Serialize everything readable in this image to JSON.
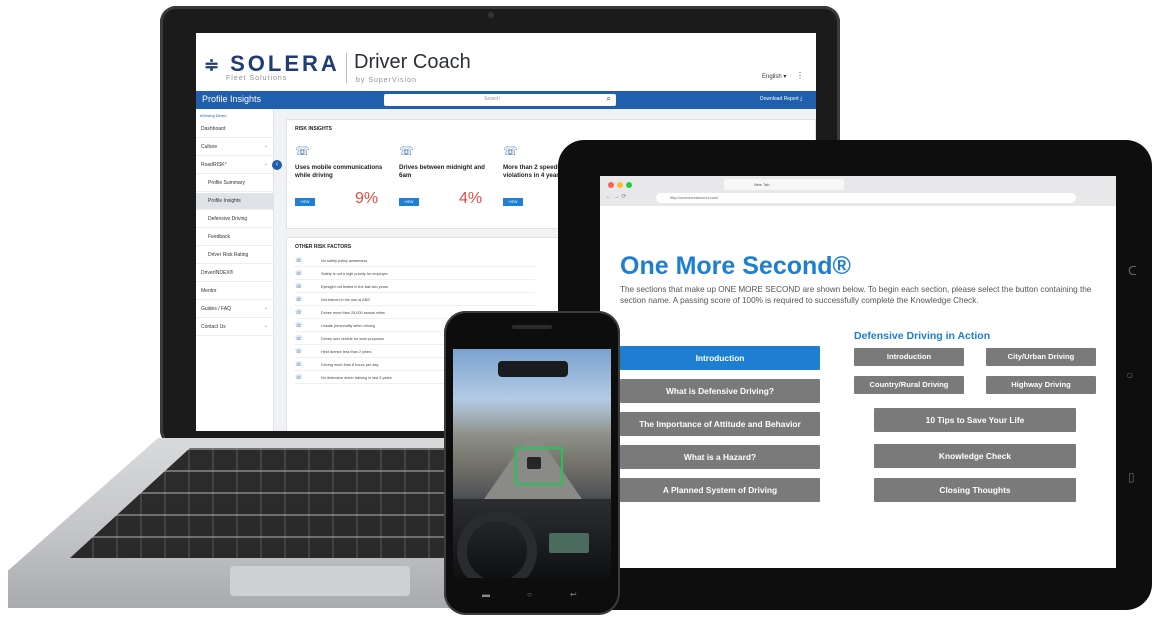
{
  "laptop": {
    "logo": "SOLERA",
    "logo_sub": "Fleet Solutions",
    "app_title": "Driver Coach",
    "app_subtitle": "by SuperVision",
    "language": "English ▾",
    "menu_icon": "⋮",
    "bar_title": "Profile Insights",
    "search_placeholder": "Search",
    "download": "Download Report",
    "sidebar_head": "eDriving Demo",
    "sidebar": [
      {
        "label": "Dashboard",
        "sub": false,
        "active": false,
        "chev": ""
      },
      {
        "label": "Culture",
        "sub": false,
        "active": false,
        "chev": "⌄"
      },
      {
        "label": "RoadRISK°",
        "sub": false,
        "active": false,
        "chev": "⌄"
      },
      {
        "label": "Profile Summary",
        "sub": true,
        "active": false,
        "chev": ""
      },
      {
        "label": "Profile Insights",
        "sub": true,
        "active": true,
        "chev": ""
      },
      {
        "label": "Defensive Driving",
        "sub": true,
        "active": false,
        "chev": ""
      },
      {
        "label": "Feedback",
        "sub": true,
        "active": false,
        "chev": ""
      },
      {
        "label": "Driver Risk Rating",
        "sub": true,
        "active": false,
        "chev": ""
      },
      {
        "label": "DriverINDEX®",
        "sub": false,
        "active": false,
        "chev": ""
      },
      {
        "label": "Mentor",
        "sub": false,
        "active": false,
        "chev": ""
      },
      {
        "label": "Guides / FAQ",
        "sub": false,
        "active": false,
        "chev": "⌄"
      },
      {
        "label": "Contact Us",
        "sub": false,
        "active": false,
        "chev": "⌄"
      }
    ],
    "risk_insights_title": "RISK INSIGHTS",
    "risks": [
      {
        "text": "Uses mobile communications while driving",
        "button": "VIEW",
        "pct": "9%"
      },
      {
        "text": "Drives between midnight and 6am",
        "button": "VIEW",
        "pct": "4%"
      },
      {
        "text": "More than 2 speeding moving violations in 4 years",
        "button": "VIEW",
        "pct": ""
      }
    ],
    "other_risk_title": "OTHER RISK FACTORS",
    "factors": [
      "No safety policy awareness",
      "Safety is not a high priority for employer",
      "Eyesight not tested in the last two years",
      "Not trained in the use of ABS",
      "Drives more than 25,000 annual miles",
      "Unsafe personality when driving",
      "Drives own vehicle for work purposes",
      "Held license less than 2 years",
      "Driving more than 8 hours per day",
      "No defensive driver training in last 3 years"
    ]
  },
  "tablet": {
    "tab_title": "New Tab",
    "url": "http://onemoresecond.com/",
    "title": "One More Second®",
    "description": "The sections that make up ONE MORE SECOND are shown below. To begin each section, please select the button containing the section name. A passing score of 100% is required to successfully complete the Knowledge Check.",
    "left_buttons": [
      "Introduction",
      "What is Defensive Driving?",
      "The Importance of Attitude and Behavior",
      "What is a Hazard?",
      "A Planned System of Driving"
    ],
    "section_title": "Defensive Driving in Action",
    "right_small": [
      "Introduction",
      "City/Urban Driving",
      "Country/Rural Driving",
      "Highway Driving"
    ],
    "right_wide": [
      "10 Tips to Save Your Life",
      "Knowledge Check",
      "Closing Thoughts"
    ]
  },
  "colors": {
    "brand_blue": "#1e7ed2",
    "solera_navy": "#1f3c74",
    "risk_red": "#e04b3f",
    "button_gray": "#7a7a7a",
    "detect_green": "#23c35a"
  }
}
